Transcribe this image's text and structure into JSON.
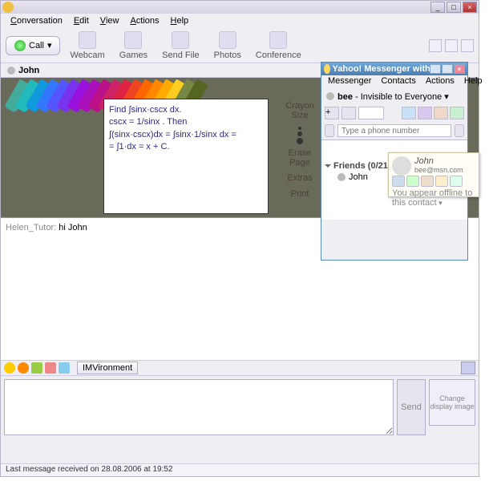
{
  "main_window": {
    "menus": {
      "conversation": "Conversation",
      "edit": "Edit",
      "view": "View",
      "actions": "Actions",
      "help": "Help"
    },
    "call_label": "Call",
    "toolbar": {
      "webcam": "Webcam",
      "games": "Games",
      "sendfile": "Send File",
      "photos": "Photos",
      "conference": "Conference"
    },
    "participant": "John",
    "whiteboard": {
      "line1": "Find ∫sinx·cscx dx.",
      "line2": "cscx = 1/sinx . Then",
      "line3": "∫(sinx·cscx)dx = ∫sinx·1/sinx dx =",
      "line4": "= ∫1·dx = x + C."
    },
    "wb_controls": {
      "crayon_size": "Crayon Size",
      "erase_page": "Erase Page",
      "extras": "Extras",
      "print": "Print"
    },
    "history": {
      "sender": "Helen_Tutor:",
      "message": "hi John"
    },
    "imvironment_label": "IMVironment",
    "send_label": "Send",
    "display_img_label": "Change display image",
    "status": "Last message received on 28.08.2006 at 19:52"
  },
  "ym_window": {
    "title": "Yahoo! Messenger with Voice (BETA)",
    "menus": {
      "messenger": "Messenger",
      "contacts": "Contacts",
      "actions": "Actions",
      "help": "Help"
    },
    "user": "bee",
    "status_text": "Invisible to Everyone",
    "phone_placeholder": "Type a phone number",
    "group": {
      "name": "Friends",
      "count": "(0/21)"
    },
    "contact": "John"
  },
  "tooltip": {
    "name": "John",
    "email": "bee@msn.com",
    "status": "You appear offline to this contact"
  },
  "crayon_colors": [
    "#4a9",
    "#2bb",
    "#19d",
    "#37f",
    "#55f",
    "#73e",
    "#91d",
    "#a1b",
    "#b18",
    "#c26",
    "#d24",
    "#e42",
    "#f60",
    "#f80",
    "#fa0",
    "#fc2",
    "#784",
    "#562"
  ]
}
